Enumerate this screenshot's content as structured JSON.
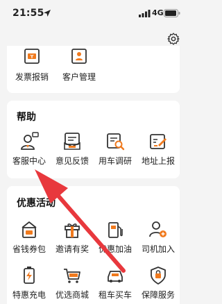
{
  "status_bar": {
    "time": "21:55",
    "network": "4G"
  },
  "top_section": {
    "items": [
      {
        "label": "发票报销",
        "icon": "invoice-icon"
      },
      {
        "label": "客户管理",
        "icon": "customer-management-icon"
      }
    ]
  },
  "help_section": {
    "title": "帮助",
    "items": [
      {
        "label": "客服中心",
        "icon": "customer-service-icon"
      },
      {
        "label": "意见反馈",
        "icon": "feedback-icon"
      },
      {
        "label": "用车调研",
        "icon": "survey-icon"
      },
      {
        "label": "地址上报",
        "icon": "address-report-icon"
      }
    ]
  },
  "promo_section": {
    "title": "优惠活动",
    "items": [
      {
        "label": "省钱券包",
        "icon": "coupon-pack-icon"
      },
      {
        "label": "邀请有奖",
        "icon": "invite-reward-icon"
      },
      {
        "label": "优惠加油",
        "icon": "fuel-discount-icon"
      },
      {
        "label": "司机加入",
        "icon": "driver-join-icon"
      },
      {
        "label": "特惠充电",
        "icon": "charging-icon"
      },
      {
        "label": "优选商城",
        "icon": "mall-icon"
      },
      {
        "label": "租车买车",
        "icon": "car-rental-icon"
      },
      {
        "label": "保障服务",
        "icon": "protection-service-icon"
      }
    ]
  },
  "colors": {
    "accent": "#f07a1e",
    "icon_stroke": "#333333",
    "arrow": "#e8383d"
  }
}
